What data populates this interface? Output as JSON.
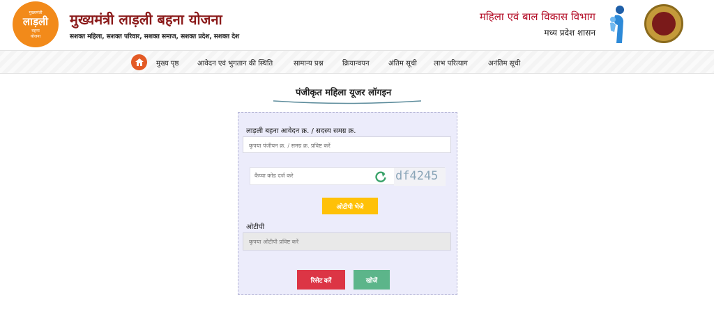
{
  "header": {
    "logo": {
      "line1": "मुख्यमंत्री",
      "line2": "लाड़ली",
      "line3": "बहना",
      "line4": "योजना"
    },
    "title": "मुख्यमंत्री लाड़ली बहना योजना",
    "tagline": "सशक्त महिला, सशक्त परिवार, सशक्त समाज, सशक्त प्रदेश, सशक्त देश",
    "department": "महिला एवं बाल विकास विभाग",
    "government": "मध्य प्रदेश शासन"
  },
  "nav": {
    "items": [
      {
        "label": "मुख्य पृष्ठ"
      },
      {
        "label": "आवेदन एवं भुगतान की स्थिति"
      },
      {
        "label": "सामान्य प्रश्न"
      },
      {
        "label": "क्रियान्वयन"
      },
      {
        "label": "अंतिम सूची"
      },
      {
        "label": "लाभ परित्याग"
      },
      {
        "label": "अनंतिम सूची"
      }
    ]
  },
  "login": {
    "title": "पंजीकृत महिला यूजर लॉगइन",
    "id_label": "लाड़ली बहना आवेदन क्र. / सदस्य समग्र क्र.",
    "id_placeholder": "कृपया पंजीयन क्र. / समग्र क्र. प्रविष्ट करें",
    "captcha_placeholder": "कैप्चा कोड दर्ज करे",
    "captcha_code": "df4245",
    "send_otp": "ओटीपी भेजे",
    "otp_label": "ओटीपी",
    "otp_placeholder": "कृपया ओटीपी प्रविष्ट करें",
    "reset": "रिसेट करें",
    "search": "खोजें"
  },
  "colors": {
    "title": "#8b1a1a",
    "logo": "#f28a1a",
    "home": "#e35a25",
    "otp_button": "#ffc107",
    "reset_button": "#dc3545",
    "search_button": "#5cb58a",
    "card": "#ececfb"
  }
}
